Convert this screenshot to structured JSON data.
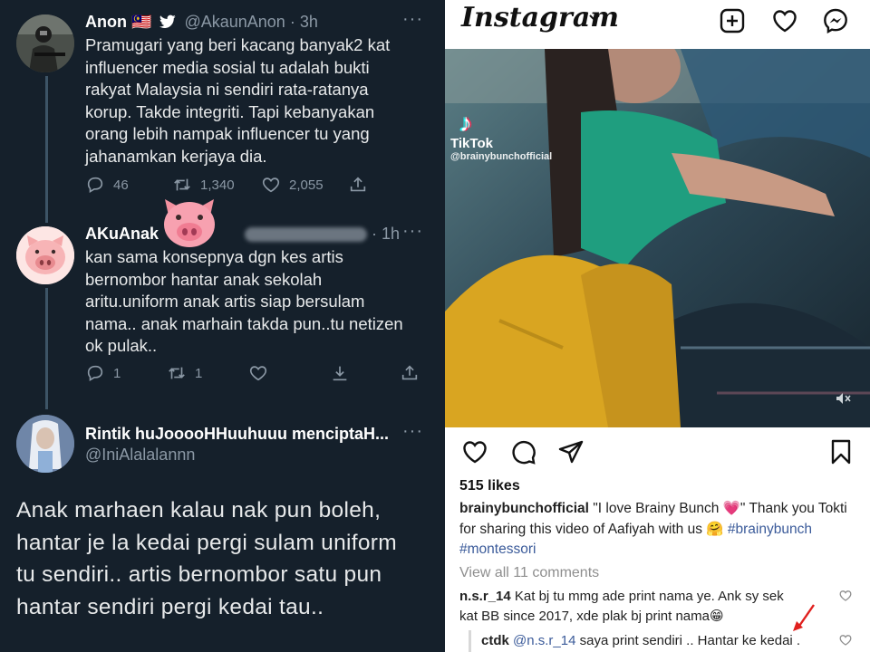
{
  "twitter": {
    "tweet1": {
      "name": "Anon",
      "flag": "🇲🇾",
      "handle": "@AkaunAnon",
      "time": "· 3h",
      "text_lines": [
        "Pramugari yang beri kacang banyak2 kat",
        "influencer media sosial tu adalah bukti",
        "rakyat Malaysia ni sendiri rata-ratanya",
        "korup. Takde integriti. Tapi kebanyakan",
        "orang lebih nampak influencer tu yang",
        "jahanamkan kerjaya dia."
      ],
      "replies": "46",
      "retweets": "1,340",
      "likes": "2,055"
    },
    "tweet2": {
      "name": "AKuAnak",
      "time": "· 1h",
      "text_lines": [
        "kan sama konsepnya dgn kes artis",
        "bernombor hantar anak sekolah",
        "aritu.uniform anak artis siap bersulam",
        "nama.. anak marhain takda pun..tu netizen",
        "ok pulak.."
      ],
      "replies": "1",
      "retweets": "1"
    },
    "tweet3": {
      "name": "Rintik huJooooHHuuhuuu menciptaH...",
      "handle": "@IniAlalalannn",
      "text_lines": [
        "Anak marhaen kalau nak pun boleh,",
        "hantar je la kedai pergi sulam uniform",
        "tu sendiri.. artis bernombor satu pun",
        "hantar sendiri pergi kedai tau.."
      ]
    },
    "more": "···"
  },
  "instagram": {
    "logo": "Instagram",
    "tiktok_label": "TikTok",
    "tiktok_user": "@brainybunchofficial",
    "likes": "515 likes",
    "caption": {
      "user": "brainybunchofficial",
      "line1": "\"I love Brainy Bunch 💗\" Thank you Tokti",
      "line2": "for sharing this video of Aafiyah with us 🤗 ",
      "hashtag1": "#brainybunch",
      "hashtag2": "#montessori"
    },
    "view_comments": "View all 11 comments",
    "comment1": {
      "user": "n.s.r_14",
      "line1": "Kat bj tu mmg ade print nama ye. Ank sy sek",
      "line2": "kat BB since 2017, xde plak bj print nama😁"
    },
    "comment2": {
      "user": "ctdk",
      "mention": "@n.s.r_14",
      "text": "saya print sendiri .. Hantar ke kedai ."
    }
  },
  "colors": {
    "twitter_bg": "#15202b",
    "twitter_muted": "#8b98a5",
    "instagram_link": "#3b5b9a",
    "arrow": "#e0201e"
  }
}
